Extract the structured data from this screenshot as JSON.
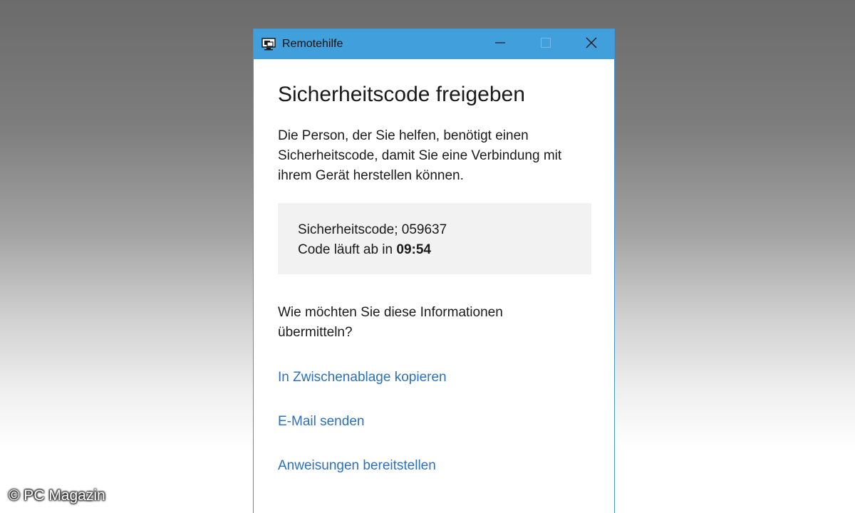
{
  "window": {
    "title": "Remotehilfe",
    "icon": "remote-desktop-icon",
    "controls": [
      "minimize-icon",
      "maximize-icon",
      "close-icon"
    ]
  },
  "main": {
    "heading": "Sicherheitscode freigeben",
    "description": "Die Person, der Sie helfen, benötigt einen Sicherheitscode, damit Sie eine Verbindung mit ihrem Gerät herstellen können.",
    "code_line": "Sicherheitscode; 059637",
    "expiry_prefix": "Code läuft ab in ",
    "expiry_time": "09:54",
    "question": "Wie möchten Sie diese Informationen übermitteln?",
    "options": {
      "clipboard": "In Zwischenablage kopieren",
      "email": "E-Mail senden",
      "instructions": "Anweisungen bereitstellen"
    }
  },
  "watermark": "© PC Magazin",
  "colors": {
    "titlebar": "#41a0dc",
    "link": "#2b6fc0",
    "codebox_bg": "#f2f2f2"
  }
}
